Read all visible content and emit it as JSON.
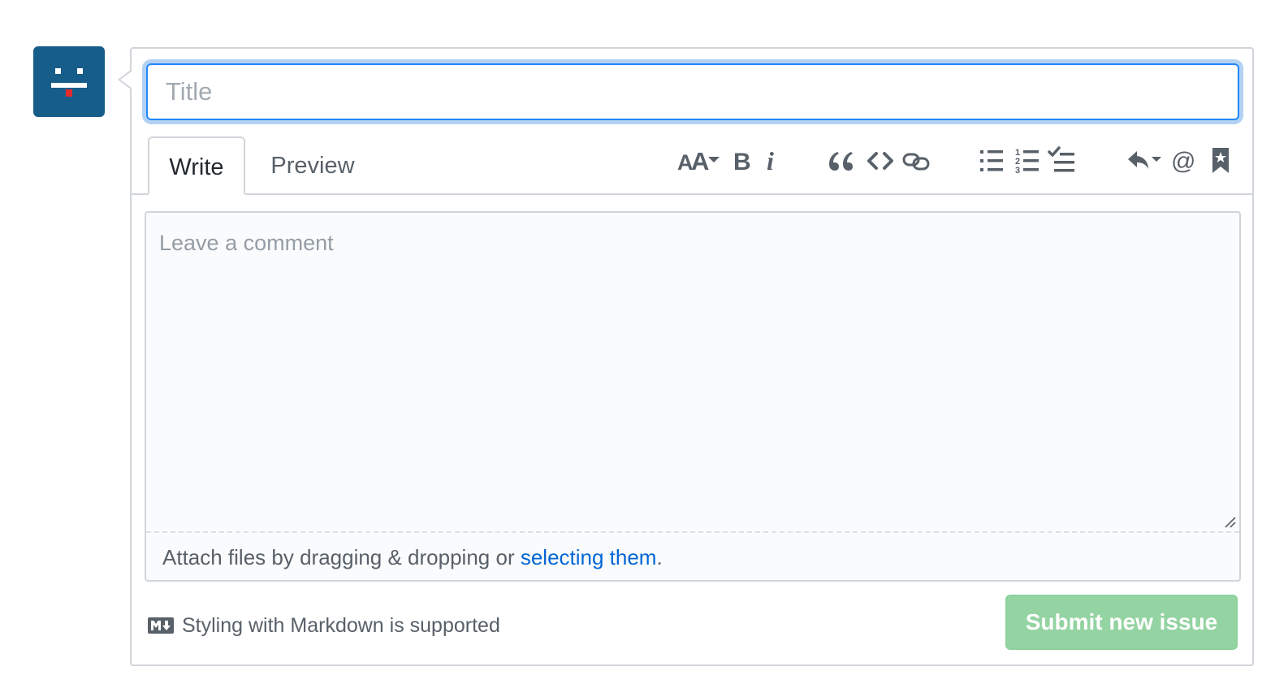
{
  "avatar": {
    "icon": "identicon-face-icon",
    "bg_color": "#175d8a"
  },
  "title_field": {
    "placeholder": "Title",
    "value": ""
  },
  "tabs": [
    {
      "label": "Write",
      "selected": true
    },
    {
      "label": "Preview",
      "selected": false
    }
  ],
  "toolbar": {
    "icons": [
      "text-size-icon",
      "bold-icon",
      "italic-icon",
      "quote-icon",
      "code-icon",
      "link-icon",
      "unordered-list-icon",
      "ordered-list-icon",
      "task-list-icon",
      "reply-icon",
      "mention-icon",
      "reference-icon"
    ]
  },
  "comment": {
    "placeholder": "Leave a comment",
    "value": "",
    "attach_text": "Attach files by dragging & dropping or ",
    "attach_link": "selecting them",
    "attach_suffix": "."
  },
  "footer": {
    "markdown_note": "Styling with Markdown is supported",
    "submit_label": "Submit new issue"
  },
  "colors": {
    "focus_blue": "#2188ff",
    "link_blue": "#0366d6",
    "submit_green_disabled": "#94d3a2"
  }
}
